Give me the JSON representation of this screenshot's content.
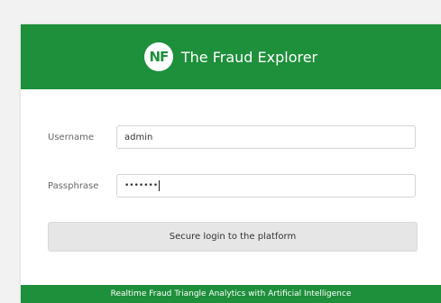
{
  "header": {
    "logo_text": "NF",
    "title": "The Fraud Explorer"
  },
  "form": {
    "username_label": "Username",
    "username_value": "admin",
    "passphrase_label": "Passphrase",
    "passphrase_mask": "•••••••",
    "submit_label": "Secure login to the platform"
  },
  "footer": {
    "tagline": "Realtime Fraud Triangle Analytics with Artificial Intelligence"
  },
  "colors": {
    "brand": "#1e8f3b",
    "background": "#f2f2f2",
    "button": "#e6e6e6"
  },
  "icons": {
    "logo": "nf-logo-icon"
  }
}
